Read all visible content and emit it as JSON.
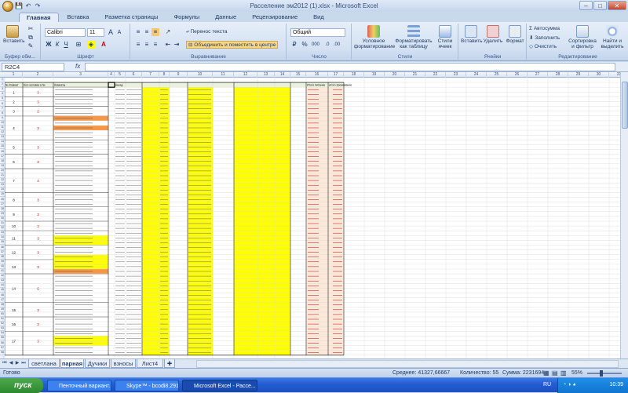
{
  "window": {
    "title": "Расселение эм2012 (1).xlsx - Microsoft Excel",
    "controls": {
      "minimize": "–",
      "maximize": "□",
      "close": "✕"
    }
  },
  "quick_access": {
    "save": "💾",
    "undo": "↶",
    "redo": "↷"
  },
  "ribbon_tabs": [
    {
      "label": "Главная",
      "active": true
    },
    {
      "label": "Вставка"
    },
    {
      "label": "Разметка страницы"
    },
    {
      "label": "Формулы"
    },
    {
      "label": "Данные"
    },
    {
      "label": "Рецензирование"
    },
    {
      "label": "Вид"
    }
  ],
  "ribbon": {
    "clipboard": {
      "label": "Буфер обм...",
      "paste": "Вставить"
    },
    "font": {
      "label": "Шрифт",
      "name": "Calibri",
      "size": "11",
      "bold": "Ж",
      "italic": "К",
      "underline": "Ч",
      "grow": "A",
      "shrink": "A"
    },
    "alignment": {
      "label": "Выравнивание",
      "wrap": "Перенос текста",
      "merge": "Объединить и поместить в центре"
    },
    "number": {
      "label": "Число",
      "format": "Общий",
      "percent": "%",
      "thousands": "000"
    },
    "styles": {
      "label": "Стили",
      "conditional": "Условное форматирование",
      "table": "Форматировать как таблицу",
      "cell": "Стили ячеек"
    },
    "cells": {
      "label": "Ячейки",
      "insert": "Вставить",
      "delete": "Удалить",
      "format": "Формат"
    },
    "editing": {
      "label": "Редактирование",
      "autosum": "Автосумма",
      "fill": "Заполнить",
      "clear": "Очистить",
      "sort": "Сортировка и фильтр",
      "find": "Найти и выделить"
    }
  },
  "formula_bar": {
    "name_box": "R2C4",
    "fx": "fx",
    "value": ""
  },
  "sheet": {
    "header_row": [
      "№ Комнат",
      "Кол-человек в №",
      "Комнаты",
      "",
      "въезд",
      "",
      "",
      "",
      "",
      "",
      "",
      "",
      "",
      "",
      "",
      "Итого питание",
      "итого проживание"
    ],
    "block_rooms": [
      {
        "room": "1",
        "count": "3"
      },
      {
        "room": "2",
        "count": "3"
      },
      {
        "room": "3",
        "count": "2"
      },
      {
        "room": "4",
        "count": "3"
      },
      {
        "room": "5",
        "count": "3"
      },
      {
        "room": "6",
        "count": "3"
      },
      {
        "room": "7",
        "count": "4"
      },
      {
        "room": "8",
        "count": "3"
      },
      {
        "room": "9",
        "count": "3"
      },
      {
        "room": "10",
        "count": "3"
      },
      {
        "room": "11",
        "count": "3"
      },
      {
        "room": "12",
        "count": "3"
      },
      {
        "room": "13",
        "count": "3"
      },
      {
        "room": "14",
        "count": "6"
      },
      {
        "room": "15",
        "count": "3"
      },
      {
        "room": "16",
        "count": "3"
      },
      {
        "room": "17",
        "count": "3"
      }
    ]
  },
  "sheet_tabs": [
    {
      "label": "светлана"
    },
    {
      "label": "парная",
      "active": true
    },
    {
      "label": "Дучики"
    },
    {
      "label": "взносы"
    },
    {
      "label": "Лист4"
    }
  ],
  "status": {
    "ready": "Готово",
    "average": "Среднее: 41327,66667",
    "count": "Количество: 55",
    "sum": "Сумма: 2231694",
    "zoom": "55%"
  },
  "taskbar": {
    "start": "пуск",
    "buttons": [
      "Пенточный вариант...",
      "Skype™ - bcodi8.291",
      "Microsoft Excel - Рассе..."
    ],
    "lang": "RU",
    "clock": "10:39"
  }
}
